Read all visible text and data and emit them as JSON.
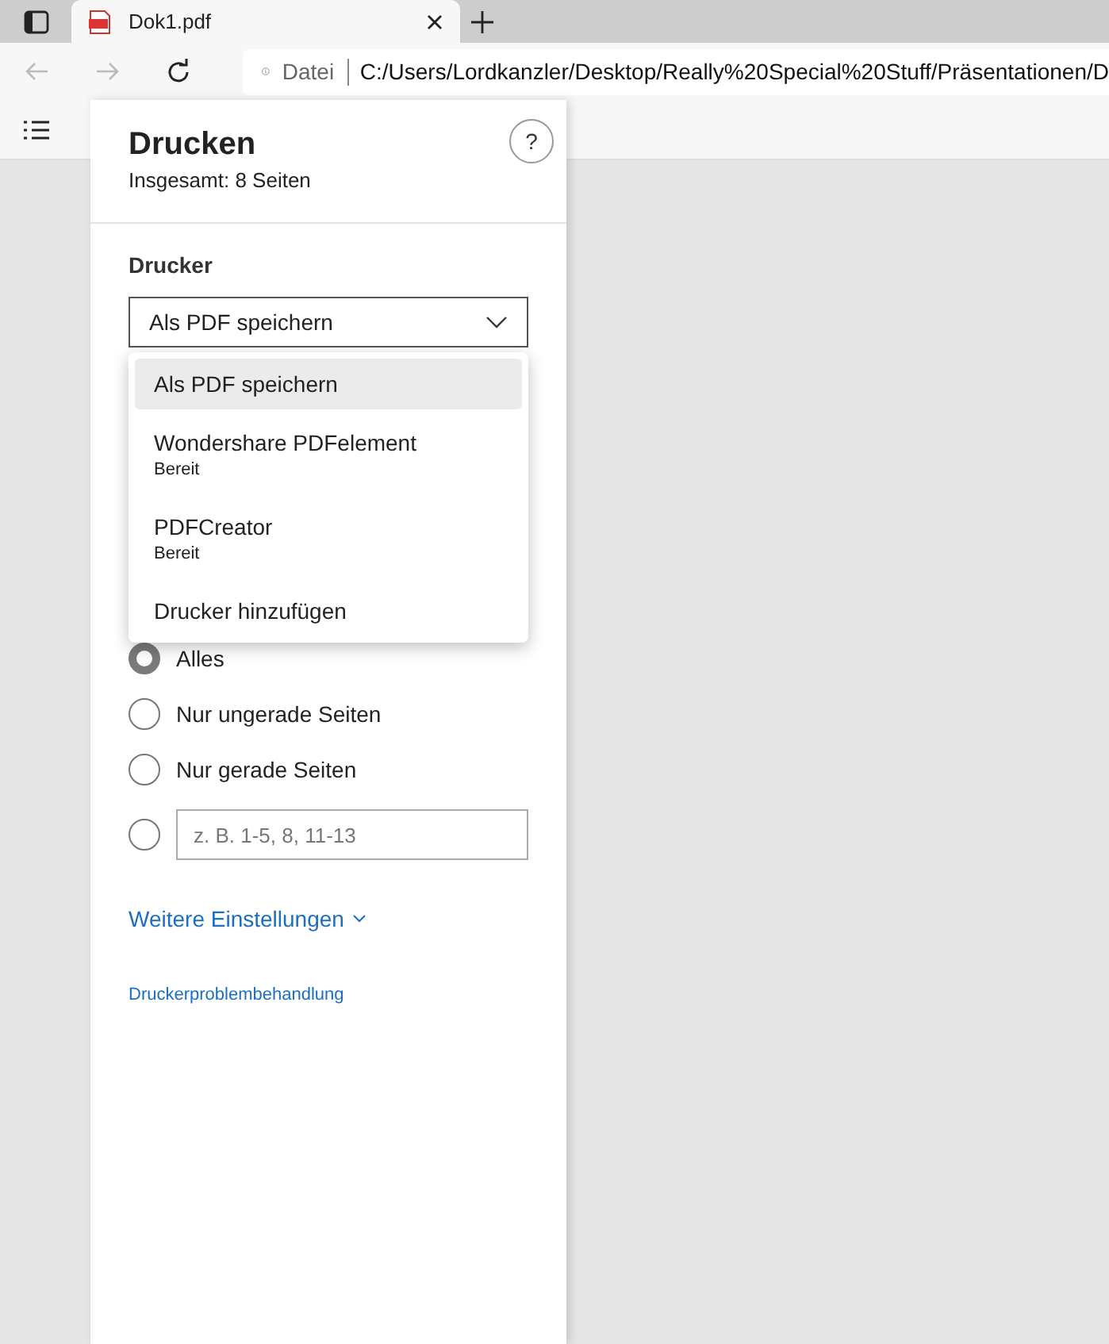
{
  "browser": {
    "tab": {
      "title": "Dok1.pdf",
      "selected": true
    },
    "address": {
      "scheme_label": "Datei",
      "url": "C:/Users/Lordkanzler/Desktop/Really%20Special%20Stuff/Präsentationen/D"
    }
  },
  "print_panel": {
    "title": "Drucken",
    "subtitle": "Insgesamt: 8 Seiten",
    "help": "?",
    "printer_label": "Drucker",
    "printer_select": {
      "value": "Als PDF speichern",
      "expanded": true
    },
    "printer_menu": [
      {
        "name": "Als PDF speichern",
        "selected": true
      },
      {
        "name": "Wondershare PDFelement",
        "status": "Bereit",
        "selected": false
      },
      {
        "name": "PDFCreator",
        "status": "Bereit",
        "selected": false
      },
      {
        "name": "Drucker hinzufügen",
        "selected": false
      }
    ],
    "pages": [
      {
        "kind": "option",
        "label": "Alles",
        "selected": true
      },
      {
        "kind": "option",
        "label": "Nur ungerade Seiten",
        "selected": false
      },
      {
        "kind": "option",
        "label": "Nur gerade Seiten",
        "selected": false
      },
      {
        "kind": "range",
        "placeholder": "z. B. 1-5, 8, 11-13",
        "selected": false
      }
    ],
    "more_settings": "Weitere Einstellungen",
    "troubleshoot": "Druckerproblembehandlung"
  }
}
